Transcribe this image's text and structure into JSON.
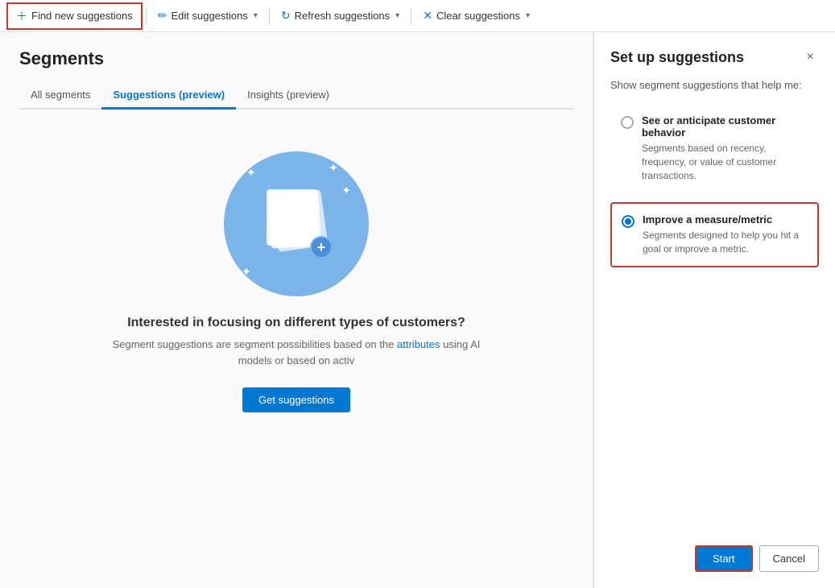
{
  "toolbar": {
    "find_suggestions_label": "Find new suggestions",
    "edit_suggestions_label": "Edit suggestions",
    "refresh_suggestions_label": "Refresh suggestions",
    "clear_suggestions_label": "Clear suggestions"
  },
  "page": {
    "title": "Segments",
    "tabs": [
      {
        "id": "all",
        "label": "All segments",
        "active": false
      },
      {
        "id": "suggestions",
        "label": "Suggestions (preview)",
        "active": true
      },
      {
        "id": "insights",
        "label": "Insights (preview)",
        "active": false
      }
    ]
  },
  "main": {
    "illustration_alt": "Segment suggestions illustration",
    "center_title": "Interested in focusing on different types of customers?",
    "center_desc": "Segment suggestions are segment possibilities based on the attributes using AI models or based on activ",
    "get_suggestions_label": "Get suggestions"
  },
  "panel": {
    "title": "Set up suggestions",
    "subtitle": "Show segment suggestions that help me:",
    "close_label": "×",
    "options": [
      {
        "id": "behavior",
        "label": "See or anticipate customer behavior",
        "desc": "Segments based on recency, frequency, or value of customer transactions.",
        "selected": false
      },
      {
        "id": "metric",
        "label": "Improve a measure/metric",
        "desc": "Segments designed to help you hit a goal or improve a metric.",
        "selected": true
      }
    ],
    "start_label": "Start",
    "cancel_label": "Cancel"
  }
}
